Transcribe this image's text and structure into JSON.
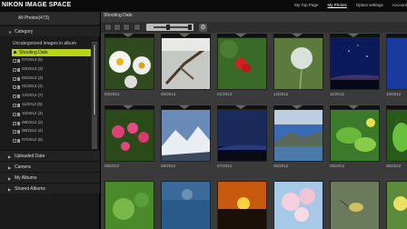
{
  "app": {
    "logo": "NIKON IMAGE SPACE"
  },
  "topnav": {
    "items": [
      "My Top Page",
      "My Photos",
      "Option settings",
      "Account"
    ]
  },
  "sidebar": {
    "all_photos": "All Photos(473)",
    "category": "Category",
    "uncategorized": "Uncategorized images in album",
    "shooting_date": "Shooting Date",
    "months": [
      "07/2013 (6)",
      "03/2013 (3)",
      "02/2013 (3)",
      "01/2013 (4)",
      "12/2012 (7)",
      "11/2012 (6)",
      "10/2012 (3)",
      "09/2012 (2)",
      "08/2012 (4)",
      "07/2012 (6)"
    ],
    "uploaded_date": "Uploaded Date",
    "camera": "Camera",
    "my_albums": "My Albums",
    "shared_albums": "Shared Albums"
  },
  "main": {
    "title": "Shooting Date",
    "photos": [
      {
        "date": "03/2013"
      },
      {
        "date": "02/2013"
      },
      {
        "date": "01/2013"
      },
      {
        "date": "12/2012"
      },
      {
        "date": "11/2012"
      },
      {
        "date": "10/2012"
      },
      {
        "date": "09/2012"
      },
      {
        "date": "08/2012"
      },
      {
        "date": "07/2012"
      },
      {
        "date": "06/2012"
      },
      {
        "date": "06/2012"
      },
      {
        "date": "05/2012"
      },
      {
        "date": ""
      },
      {
        "date": ""
      },
      {
        "date": ""
      },
      {
        "date": ""
      },
      {
        "date": ""
      },
      {
        "date": ""
      }
    ]
  },
  "colors": {
    "accent": "#b8d617",
    "background": "#3a3a3a",
    "sidebar": "#1b1b1b"
  }
}
